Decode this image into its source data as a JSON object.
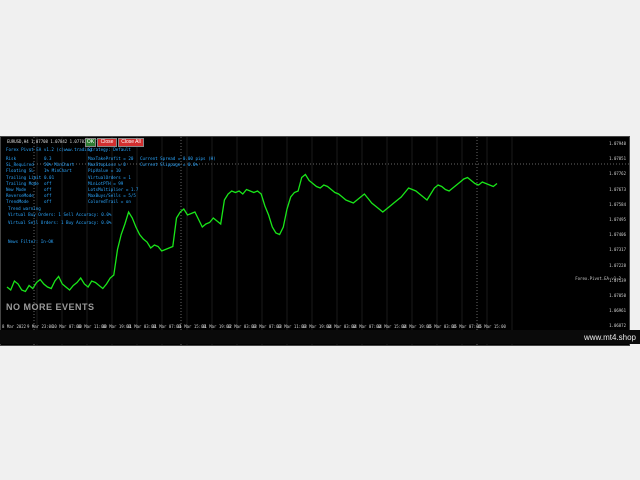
{
  "window": {
    "title": "EURUSD,H4  1.07708 1.07842 1.07702 1.07748",
    "corner": "Forex.Pivot.EA v1.2"
  },
  "toolbar": {
    "ok": "OK",
    "close": "Close",
    "close_all": "Close All"
  },
  "panel_top": {
    "line1": "Forex Pivot EA v1.2 (c)www.trading",
    "line2": "Strategy: Default"
  },
  "panel_rows": [
    {
      "k": "Risk",
      "v": "0.3",
      "k2": "MaxTakeProfit = 20",
      "k3": "Current Spread = 0.00 pips (H)"
    },
    {
      "k": "SL_Required",
      "v": "50% MinChart",
      "k2": "MaxStopLoss = 0",
      "k3": "Current Slippage = 0.0%"
    },
    {
      "k": "Floating SL",
      "v": "1% MinChart",
      "k2": "PipValue = 10",
      "k3": ""
    },
    {
      "k": "Trailing Limit",
      "v": "0.01",
      "k2": "VirtualOrders = 1",
      "k3": ""
    },
    {
      "k": "Trailing Mode",
      "v": "off",
      "k2": "MinLotPTH = 99",
      "k3": ""
    },
    {
      "k": "New Mode",
      "v": "off",
      "k2": "LotsMultiplier = 1.7",
      "k3": ""
    },
    {
      "k": "ReverseMode",
      "v": "off",
      "k2": "MaxBuys/Sells = 5/5",
      "k3": ""
    },
    {
      "k": "TrendMode",
      "v": "off",
      "k2": "ColoredTrail = on",
      "k3": ""
    }
  ],
  "panel_status": [
    "Trend warning",
    "Virtual Buy Orders: 1     Sell Accuracy: 0.0%",
    "Virtual Sell Orders: 1     Buy Accuracy: 0.0%",
    "News Filter: In-OK"
  ],
  "overlay": {
    "no_more_events": "NO MORE EVENTS"
  },
  "price_axis": [
    "1.07940",
    "1.07851",
    "1.07762",
    "1.07673",
    "1.07584",
    "1.07495",
    "1.07406",
    "1.07317",
    "1.07228",
    "1.07139",
    "1.07050",
    "1.06961",
    "1.06872"
  ],
  "time_axis": [
    "8 Mar 2022",
    "9 Mar 23:00",
    "10 Mar 07:00",
    "10 Mar 11:00",
    "10 Mar 19:00",
    "11 Mar 03:00",
    "11 Mar 07:00",
    "11 Mar 15:00",
    "11 Mar 19:00",
    "12 Mar 03:00",
    "13 Mar 07:00",
    "13 Mar 11:00",
    "13 Mar 19:00",
    "14 Mar 03:00",
    "14 Mar 07:00",
    "14 Mar 15:00",
    "14 Mar 19:00",
    "15 Mar 03:00",
    "15 Mar 07:00",
    "15 Mar 15:00"
  ],
  "site": "www.mt4.shop",
  "colors": {
    "candle": "#19e619",
    "panel_text": "#2ba7ff",
    "background": "#000000"
  },
  "chart_data": {
    "type": "line",
    "series": [
      {
        "values": [
          0.2,
          0.18,
          0.24,
          0.22,
          0.18,
          0.17,
          0.21,
          0.19,
          0.23,
          0.25,
          0.22,
          0.2,
          0.19,
          0.24,
          0.27,
          0.22,
          0.2,
          0.18,
          0.21,
          0.23,
          0.26,
          0.22,
          0.2,
          0.24,
          0.23,
          0.21,
          0.19,
          0.22,
          0.26,
          0.28,
          0.45,
          0.55,
          0.62,
          0.7,
          0.66,
          0.6,
          0.55,
          0.52,
          0.5,
          0.46,
          0.48,
          0.47,
          0.44,
          0.45,
          0.46,
          0.47,
          0.66,
          0.7,
          0.72,
          0.68,
          0.69,
          0.7,
          0.65,
          0.6,
          0.62,
          0.63,
          0.66,
          0.64,
          0.62,
          0.78,
          0.82,
          0.84,
          0.83,
          0.84,
          0.82,
          0.85,
          0.84,
          0.83,
          0.84,
          0.82,
          0.74,
          0.68,
          0.6,
          0.56,
          0.55,
          0.6,
          0.72,
          0.8,
          0.83,
          0.84,
          0.93,
          0.95,
          0.91,
          0.89,
          0.87,
          0.86,
          0.88,
          0.87,
          0.85,
          0.83,
          0.82,
          0.8,
          0.78,
          0.77,
          0.76,
          0.78,
          0.8,
          0.82,
          0.79,
          0.76,
          0.74,
          0.72,
          0.7,
          0.72,
          0.74,
          0.76,
          0.78,
          0.8,
          0.83,
          0.86,
          0.85,
          0.84,
          0.82,
          0.8,
          0.78,
          0.82,
          0.86,
          0.88,
          0.87,
          0.85,
          0.84,
          0.86,
          0.88,
          0.9,
          0.92,
          0.93,
          0.91,
          0.89,
          0.88,
          0.9,
          0.89,
          0.88,
          0.87,
          0.89
        ]
      }
    ]
  }
}
